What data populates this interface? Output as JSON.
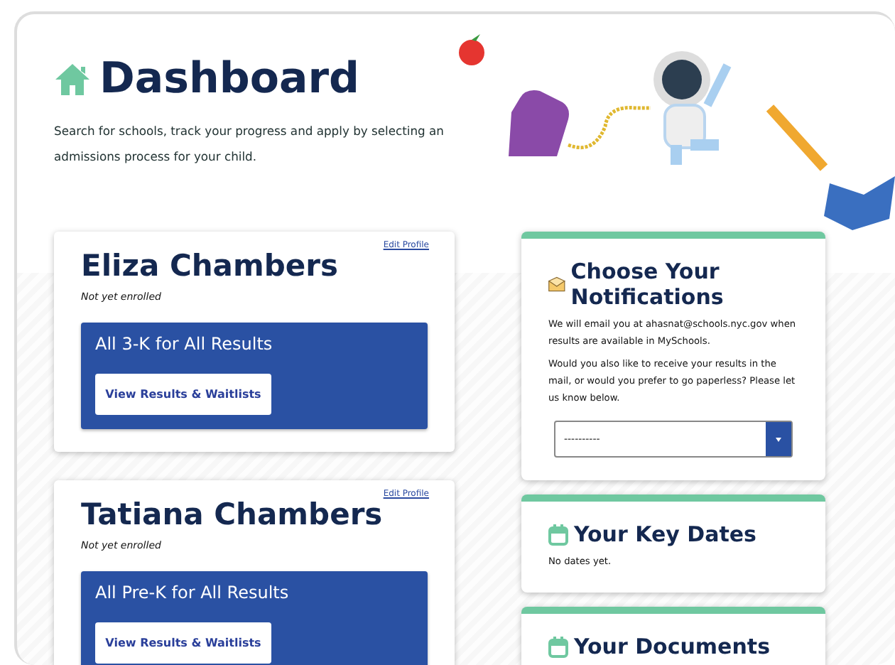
{
  "header": {
    "title": "Dashboard",
    "description": "Search for schools, track your progress and apply by selecting an admissions process for your child."
  },
  "students": [
    {
      "name": "Eliza Chambers",
      "edit_link": "Edit Profile",
      "status": "Not yet enrolled",
      "process": "All 3-K for All Results",
      "button": "View Results & Waitlists"
    },
    {
      "name": "Tatiana Chambers",
      "edit_link": "Edit Profile",
      "status": "Not yet enrolled",
      "process": "All Pre-K for All Results",
      "button": "View Results & Waitlists"
    }
  ],
  "panels": [
    {
      "kind": "notifications",
      "title": "Choose Your Notifications",
      "paragraphs": [
        "We will email you at ahasnat@schools.nyc.gov when results are available in MySchools.",
        "Would you also like to receive your results in the mail, or would you prefer to go paperless? Please let us know below."
      ],
      "select": {
        "value": "----------"
      }
    },
    {
      "kind": "dates",
      "title": "Your Key Dates",
      "paragraphs": [
        "No dates yet."
      ]
    },
    {
      "kind": "documents",
      "title": "Your Documents"
    }
  ]
}
